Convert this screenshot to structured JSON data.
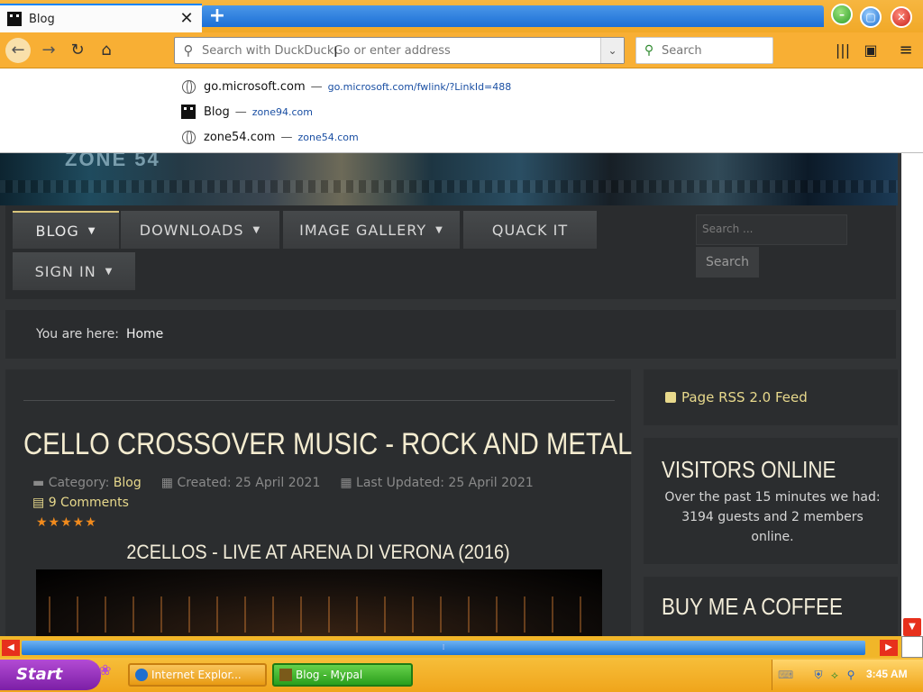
{
  "browser": {
    "tab": {
      "title": "Blog",
      "close_glyph": "✕"
    },
    "new_tab_glyph": "+",
    "url_placeholder": "Search with DuckDuckGo or enter address",
    "search_placeholder": "Search",
    "accent": "#0a84ff"
  },
  "autocomplete": [
    {
      "title": "go.microsoft.com",
      "url": "go.microsoft.com/fwlink/?LinkId=488",
      "icon": "globe-icon"
    },
    {
      "title": "Blog",
      "url": "zone94.com",
      "icon": "site-favicon"
    },
    {
      "title": "zone54.com",
      "url": "zone54.com",
      "icon": "globe-icon"
    }
  ],
  "site": {
    "logo": "ZONE 54",
    "menu": {
      "blog": "BLOG",
      "downloads": "DOWNLOADS",
      "gallery": "IMAGE GALLERY",
      "quack": "QUACK IT",
      "signin": "SIGN IN"
    },
    "search_placeholder": "Search ...",
    "search_button": "Search",
    "breadcrumb": {
      "label": "You are here:",
      "home": "Home"
    },
    "article": {
      "title": "CELLO CROSSOVER MUSIC - ROCK AND METAL",
      "category_label": "Category:",
      "category": "Blog",
      "created": "Created: 25 April 2021",
      "updated": "Last Updated: 25 April 2021",
      "comments": "9 Comments",
      "rating": "★★★★★",
      "subheading": "2CELLOS - LIVE AT ARENA DI VERONA (2016)"
    },
    "sidebar": {
      "rss": "Page RSS 2.0 Feed",
      "visitors_title": "VISITORS ONLINE",
      "visitors_text": "Over the past 15 minutes we had: 3194 guests and 2 members online.",
      "coffee_title": "BUY ME A COFFEE"
    }
  },
  "taskbar": {
    "start": "Start",
    "tasks": [
      {
        "label": "Internet Explor..."
      },
      {
        "label": "Blog - Mypal"
      }
    ],
    "clock": "3:45 AM"
  }
}
